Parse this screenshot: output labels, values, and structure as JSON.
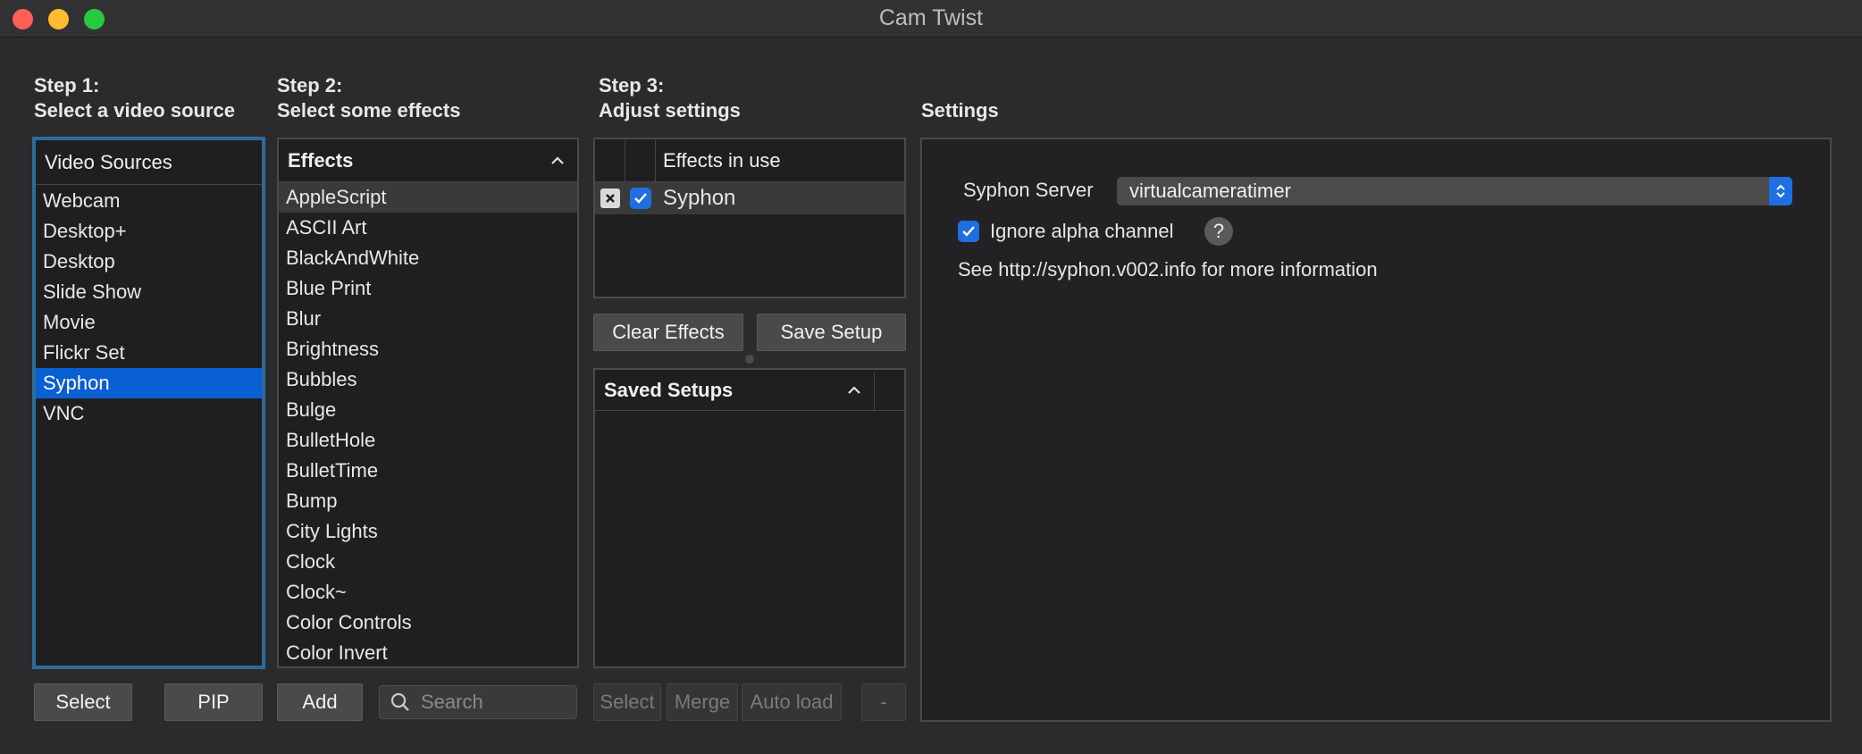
{
  "window": {
    "title": "Cam Twist"
  },
  "steps": {
    "step1": {
      "label": "Step 1:",
      "desc": "Select a video source"
    },
    "step2": {
      "label": "Step 2:",
      "desc": "Select some effects"
    },
    "step3": {
      "label": "Step 3:",
      "desc": "Adjust settings"
    },
    "settings_heading": "Settings"
  },
  "video_sources": {
    "header": "Video Sources",
    "items": [
      "Webcam",
      "Desktop+",
      "Desktop",
      "Slide Show",
      "Movie",
      "Flickr Set",
      "Syphon",
      "VNC"
    ],
    "selected": "Syphon"
  },
  "effects": {
    "header": "Effects",
    "items": [
      "AppleScript",
      "ASCII Art",
      "BlackAndWhite",
      "Blue Print",
      "Blur",
      "Brightness",
      "Bubbles",
      "Bulge",
      "BulletHole",
      "BulletTime",
      "Bump",
      "City Lights",
      "Clock",
      "Clock~",
      "Color Controls",
      "Color Invert"
    ],
    "highlighted": "AppleScript"
  },
  "effects_in_use": {
    "header": "Effects in use",
    "rows": [
      {
        "name": "Syphon",
        "checked": true
      }
    ]
  },
  "buttons": {
    "select": "Select",
    "pip": "PIP",
    "add": "Add",
    "clear_effects": "Clear Effects",
    "save_setup": "Save Setup",
    "saved_select": "Select",
    "merge": "Merge",
    "auto_load": "Auto load",
    "minus": "-"
  },
  "search": {
    "placeholder": "Search"
  },
  "saved_setups": {
    "header": "Saved Setups"
  },
  "settings": {
    "syphon_server_label": "Syphon Server",
    "syphon_server_value": "virtualcameratimer",
    "ignore_alpha_label": "Ignore alpha channel",
    "ignore_alpha_checked": true,
    "help_glyph": "?",
    "info_text": "See http://syphon.v002.info for more information"
  },
  "colors": {
    "accent": "#1f6fe0",
    "selection": "#0a5fd3",
    "focus_ring": "#2e6b9b"
  }
}
